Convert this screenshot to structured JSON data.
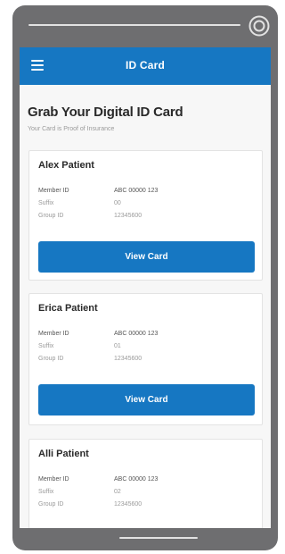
{
  "app": {
    "title": "ID Card"
  },
  "header": {
    "heading": "Grab Your Digital ID Card",
    "subheading": "Your Card is Proof of Insurance"
  },
  "labels": {
    "member_id": "Member ID",
    "suffix": "Suffix",
    "group_id": "Group ID"
  },
  "cards": [
    {
      "name": "Alex Patient",
      "member_id": "ABC 00000 123",
      "suffix": "00",
      "group_id": "12345600",
      "button": "View Card"
    },
    {
      "name": "Erica Patient",
      "member_id": "ABC 00000 123",
      "suffix": "01",
      "group_id": "12345600",
      "button": "View Card"
    },
    {
      "name": "Alli Patient",
      "member_id": "ABC 00000 123",
      "suffix": "02",
      "group_id": "12345600"
    }
  ],
  "colors": {
    "brand": "#1677c2",
    "frame": "#6e6e70"
  },
  "icons": {
    "menu": "menu-icon",
    "settings": "circle-button-icon"
  }
}
